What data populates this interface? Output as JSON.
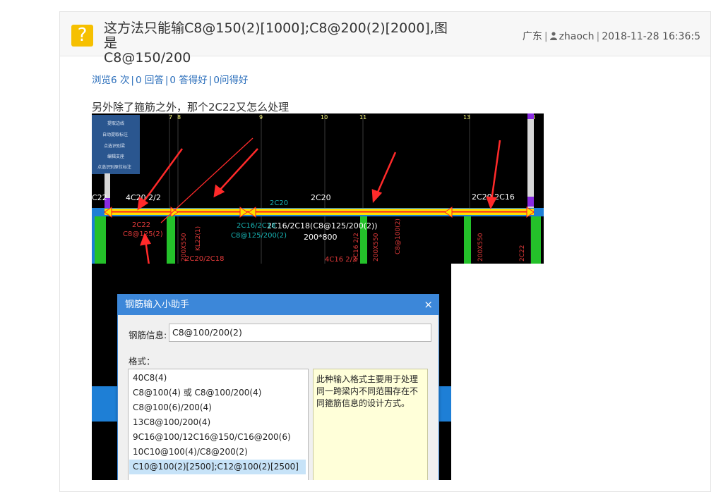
{
  "question": {
    "icon": "question-mark-icon",
    "icon_char": "?",
    "title_line1": "这方法只能输C8@150(2)[1000];C8@200(2)[2000],图是",
    "title_line2": "C8@150/200",
    "location": "广东",
    "user": "zhaoch",
    "datetime": "2018-11-28 16:36:5"
  },
  "stats": {
    "views": "浏览6 次",
    "answers": "0 回答",
    "good_answers": "0 答得好",
    "good_questions": "0问得好"
  },
  "body_text": "另外除了箍筋之外，那个2C22又怎么处理",
  "cad": {
    "toolbar": [
      "提取边线",
      "自动提取标注",
      "点选识别梁",
      "编辑支座",
      "点选识别原位标注"
    ],
    "axis_labels": [
      "7",
      "8",
      "9",
      "10",
      "11",
      "13",
      "14"
    ],
    "annotations": {
      "a1": "4C20 2/2",
      "a2": "2C20",
      "a3": "2C20 2C16",
      "a4": "2C16/2C18(C8@125/200(2))",
      "a5": "200*800",
      "a6": "2C22",
      "a7": "C8@125(2)",
      "a8": "4C16 2/2",
      "a9": "C22",
      "a10": "2C20",
      "a11": "KL22(1)",
      "a12": "200X550",
      "a13": "2C20/2C18",
      "a14": "2C16/2C18",
      "a15": "C8@125/200(2)",
      "a16": "4C16 2/2",
      "a17": "200X550",
      "a18": "C8@100(2)",
      "a19": "200X550",
      "a20": "2C22"
    },
    "colors": {
      "beam_yellow": "#ffe000",
      "beam_red": "#ff2020",
      "arrow_red": "#ff2a2a",
      "column_green": "#24c12a",
      "annotation_cyan": "#17b3b3",
      "annotation_white": "#ffffff",
      "annotation_red": "#e23a3a",
      "column_purple": "#8a2be2"
    }
  },
  "dialog": {
    "title": "钢筋输入小助手",
    "close": "×",
    "info_label": "钢筋信息:",
    "info_value": "C8@100/200(2)",
    "format_label": "格式：",
    "formats": [
      "40C8(4)",
      "C8@100(4) 或 C8@100/200(4)",
      "C8@100(6)/200(4)",
      "13C8@100/200(4)",
      "9C16@100/12C16@150/C16@200(6)",
      "10C10@100(4)/C8@200(2)",
      "C10@100(2)[2500];C12@100(2)[2500]"
    ],
    "selected_index": 6,
    "description": "此种输入格式主要用于处理同一跨梁内不同范围存在不同箍筋信息的设计方式。"
  }
}
